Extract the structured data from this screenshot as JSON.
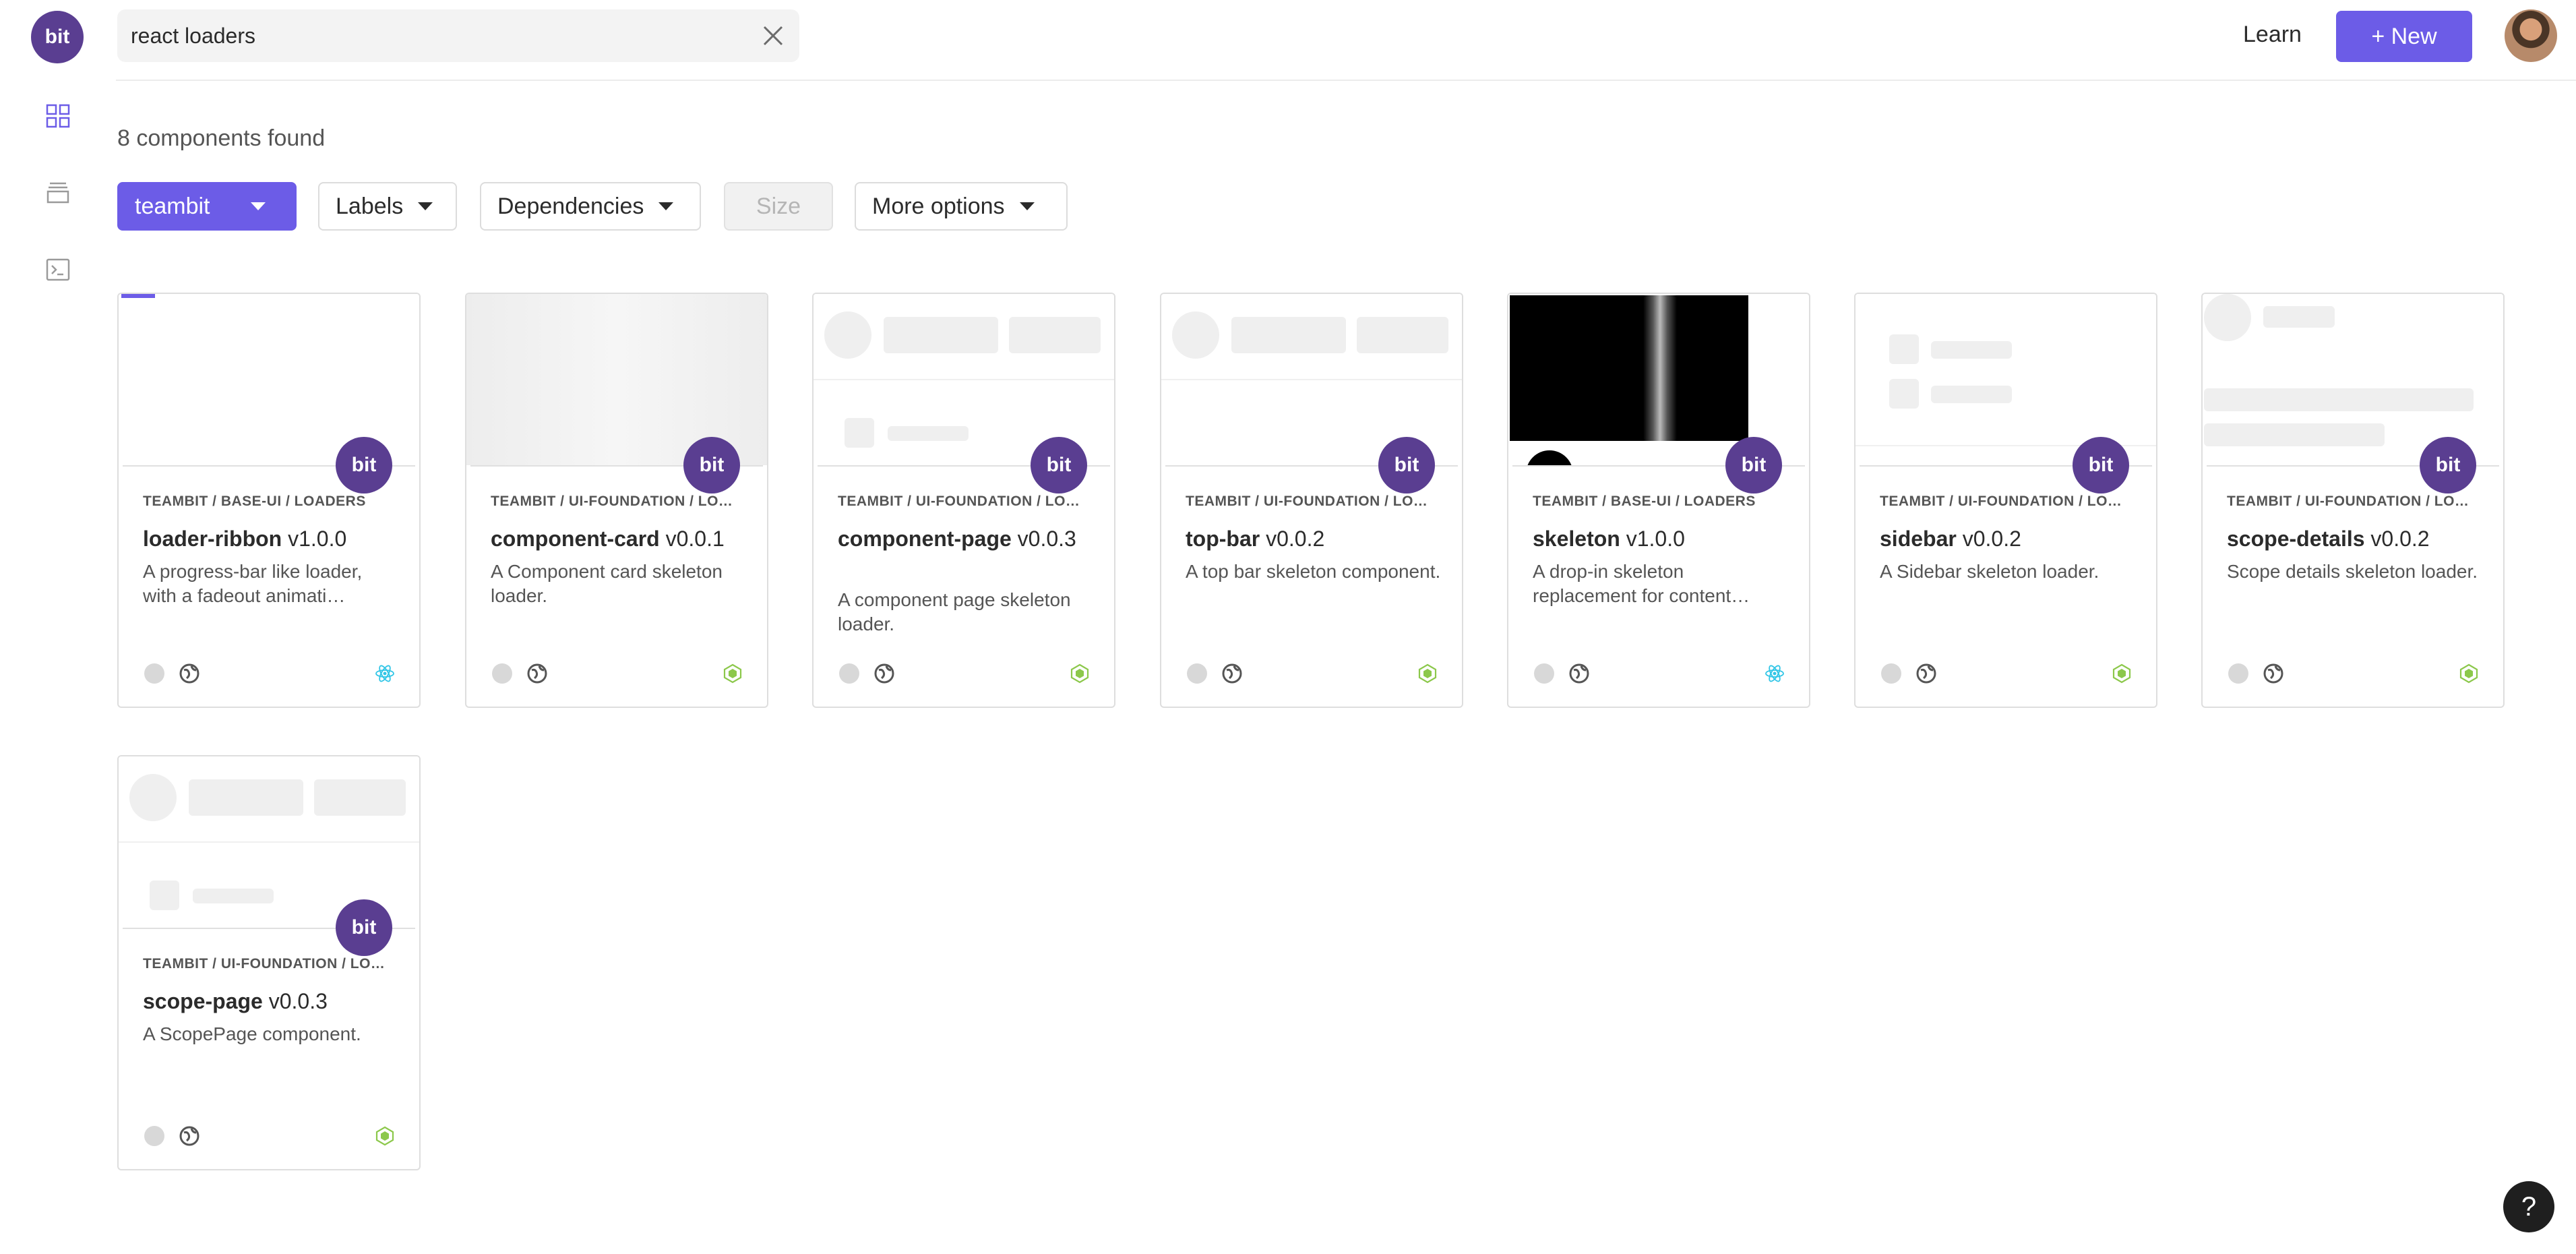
{
  "brand": {
    "logo_text": "bit",
    "accent": "#6c5ce7",
    "bit_purple": "#5a3e91"
  },
  "rail": {
    "icons": [
      "grid-icon",
      "stack-icon",
      "terminal-icon"
    ]
  },
  "search": {
    "value": "react loaders",
    "placeholder": ""
  },
  "header": {
    "learn_label": "Learn",
    "new_label": "+ New"
  },
  "results": {
    "found_text": "8 components found"
  },
  "filters": {
    "owner": "teambit",
    "labels": "Labels",
    "dependencies": "Dependencies",
    "size": "Size",
    "more": "More options"
  },
  "badge_text": "bit",
  "help_label": "?",
  "cards": [
    {
      "scope": "TEAMBIT / BASE-UI / LOADERS",
      "name": "loader-ribbon",
      "version": "v1.0.0",
      "desc": "A progress-bar like loader, with a fadeout animati…",
      "env": "react-icon"
    },
    {
      "scope": "TEAMBIT / UI-FOUNDATION / LO…",
      "name": "component-card",
      "version": "v0.0.1",
      "desc": "A Component card skeleton loader.",
      "env": "node-icon"
    },
    {
      "scope": "TEAMBIT / UI-FOUNDATION / LO…",
      "name": "component-page",
      "version": "v0.0.3",
      "desc": "A component page skeleton loader.",
      "env": "node-icon"
    },
    {
      "scope": "TEAMBIT / UI-FOUNDATION / LO…",
      "name": "top-bar",
      "version": "v0.0.2",
      "desc": "A top bar skeleton component.",
      "env": "node-icon"
    },
    {
      "scope": "TEAMBIT / BASE-UI / LOADERS",
      "name": "skeleton",
      "version": "v1.0.0",
      "desc": "A drop-in skeleton replacement for content…",
      "env": "react-icon"
    },
    {
      "scope": "TEAMBIT / UI-FOUNDATION / LO…",
      "name": "sidebar",
      "version": "v0.0.2",
      "desc": "A Sidebar skeleton loader.",
      "env": "node-icon"
    },
    {
      "scope": "TEAMBIT / UI-FOUNDATION / LO…",
      "name": "scope-details",
      "version": "v0.0.2",
      "desc": "Scope details skeleton loader.",
      "env": "node-icon"
    },
    {
      "scope": "TEAMBIT / UI-FOUNDATION / LO…",
      "name": "scope-page",
      "version": "v0.0.3",
      "desc": "A ScopePage component.",
      "env": "node-icon"
    }
  ]
}
